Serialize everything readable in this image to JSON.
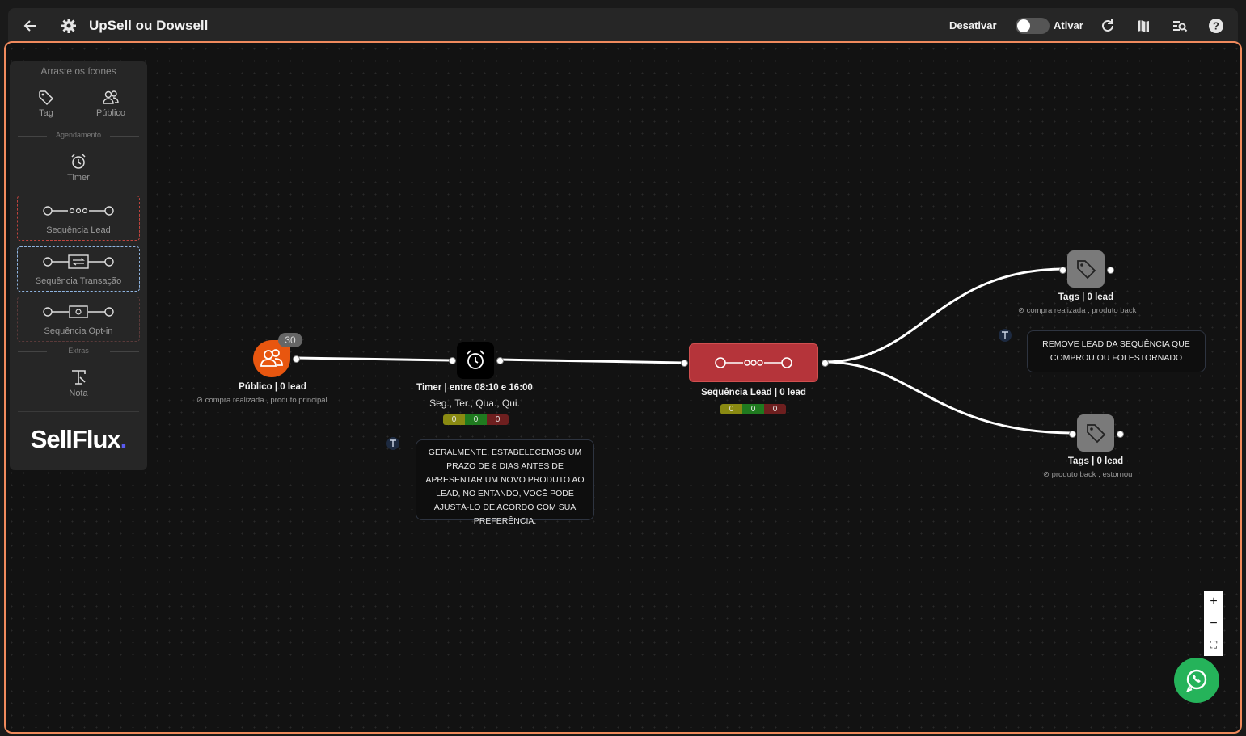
{
  "header": {
    "title": "UpSell ou Dowsell",
    "deactivate_label": "Desativar",
    "activate_label": "Ativar",
    "toggle_state": "off"
  },
  "palette": {
    "heading": "Arraste os ícones",
    "tag_label": "Tag",
    "public_label": "Público",
    "scheduling_section": "Agendamento",
    "timer_label": "Timer",
    "seq_lead_label": "Sequência Lead",
    "seq_transaction_label": "Sequência Transação",
    "seq_optin_label": "Sequência Opt-in",
    "extras_section": "Extras",
    "note_label": "Nota",
    "brand": "SellFlux",
    "brand_dot": "."
  },
  "nodes": {
    "public": {
      "badge": "30",
      "label": "Público | 0 lead",
      "tags": "compra realizada , produto principal"
    },
    "timer": {
      "label": "Timer | entre 08:10 e 16:00",
      "days": "Seg., Ter., Qua., Qui.",
      "counters": [
        "0",
        "0",
        "0"
      ]
    },
    "sequence": {
      "label": "Sequência Lead | 0 lead",
      "counters": [
        "0",
        "0",
        "0"
      ]
    },
    "tags_top": {
      "label": "Tags | 0 lead",
      "tags": "compra realizada , produto back"
    },
    "tags_bottom": {
      "label": "Tags | 0 lead",
      "tags": "produto back , estornou"
    }
  },
  "notes": {
    "timer_note": "GERALMENTE, ESTABELECEMOS UM PRAZO DE 8 DIAS ANTES DE APRESENTAR UM NOVO PRODUTO AO LEAD, NO ENTANDO, VOCÊ PODE AJUSTÁ-LO DE ACORDO COM SUA PREFERÊNCIA.",
    "tags_note": "REMOVE LEAD DA SEQUÊNCIA QUE COMPROU OU FOI ESTORNADO"
  },
  "zoom_controls": [
    "+",
    "−",
    "⛶"
  ],
  "colors": {
    "accent_border": "#f08a5d",
    "public_node": "#e8560f",
    "sequence_node": "#b5343a",
    "tag_node": "#7a7a7a",
    "whatsapp": "#25b35a"
  }
}
